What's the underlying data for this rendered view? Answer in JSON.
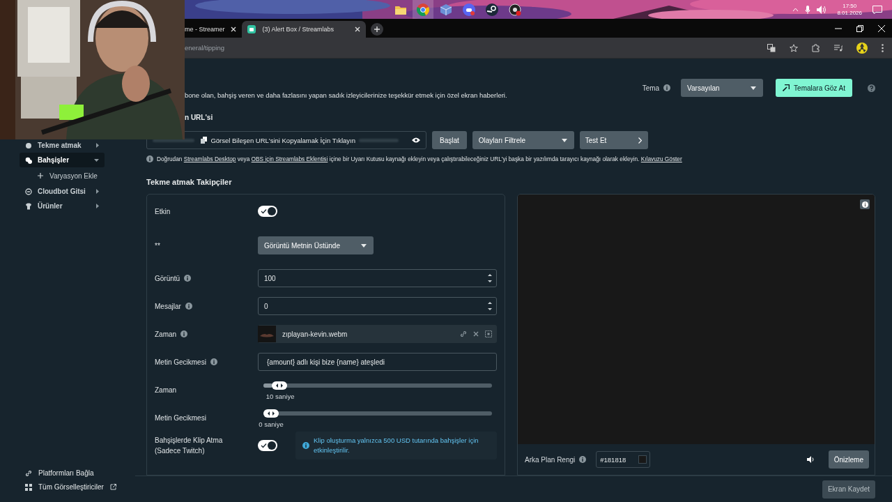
{
  "desktop": {
    "clock": {
      "time": "17:50",
      "date": "8.01.2026"
    }
  },
  "browser": {
    "tabs": [
      {
        "title": "me - Streamer",
        "selected": false
      },
      {
        "title": "(3) Alert Box / Streamlabs",
        "selected": true
      }
    ],
    "address": "eneral/tipping"
  },
  "sidebar": {
    "items": [
      {
        "label": "Tekme atmak",
        "selected": false,
        "expanded": false
      },
      {
        "label": "Bahşişler",
        "selected": true,
        "expanded": true,
        "children": [
          {
            "label": "Varyasyon Ekle"
          }
        ]
      },
      {
        "label": "Cloudbot Gitsi",
        "selected": false,
        "expanded": false
      },
      {
        "label": "Ürünler",
        "selected": false,
        "expanded": false
      }
    ],
    "footer_links": [
      "Platformları Bağla",
      "Tüm Görselleştiriciler"
    ]
  },
  "header": {
    "description": "bone olan, bahşiş veren ve daha fazlasını yapan sadık izleyicilerinize teşekkür etmek için özel ekran haberleri.",
    "theme_label": "Tema",
    "theme_value": "Varsayılan",
    "browse_button": "Temalara Göz At",
    "url_heading": "n URL'si"
  },
  "url_bar": {
    "copy_text": "Görsel Bileşen URL'sini Kopyalamak İçin Tıklayın",
    "start_button": "Başlat",
    "filter": "Olayları Filtrele",
    "test_button": "Test Et"
  },
  "hint": [
    {
      "kind": "text",
      "text": "Doğrudan "
    },
    {
      "kind": "link",
      "text": "Streamlabs Desktop"
    },
    {
      "kind": "text",
      "text": " veya "
    },
    {
      "kind": "link",
      "text": "OBS için Streamlabs Eklentisi"
    },
    {
      "kind": "text",
      "text": " içine bir Uyarı Kutusu kaynağı ekleyin veya çalıştırabileceğiniz URL'yi başka bir yazılımda tarayıcı kaynağı olarak ekleyin. "
    },
    {
      "kind": "link",
      "text": "Kılavuzu Göster"
    }
  ],
  "section_title": "Tekme atmak Takipçiler",
  "form": {
    "rows": [
      {
        "kind": "toggle",
        "label": "Etkin",
        "info": false,
        "on": true
      },
      {
        "kind": "select",
        "label": "**",
        "info": false,
        "value": "Görüntü Metnin Üstünde"
      },
      {
        "kind": "number",
        "label": "Görüntü",
        "info": true,
        "value": "100"
      },
      {
        "kind": "number",
        "label": "Mesajlar",
        "info": true,
        "value": "0"
      },
      {
        "kind": "file",
        "label": "Zaman",
        "info": true,
        "value": "zıplayan-kevin.webm"
      },
      {
        "kind": "text",
        "label": "Metin Gecikmesi",
        "info": true,
        "value": "{amount} adlı kişi bize {name} ateşledi"
      },
      {
        "kind": "slider",
        "label": "Zaman",
        "info": false,
        "level": 0.04,
        "reading": "10 saniye"
      },
      {
        "kind": "slider",
        "label": "Metin Gecikmesi",
        "info": false,
        "level": 0,
        "reading": "0 saniye"
      },
      {
        "kind": "toggle",
        "label": "Bahşişlerde Klip Atma\n(Sadece Twitch)",
        "info": false,
        "on": true,
        "note": "Klip oluşturma yalnızca 500 USD tutarında bahşişler için etkinleştirilir."
      }
    ]
  },
  "preview": {
    "background_label": "Arka Plan Rengi",
    "background_value": "#181818",
    "preview_button": "Önizleme"
  },
  "footer": {
    "record_button": "Ekran Kaydet"
  }
}
